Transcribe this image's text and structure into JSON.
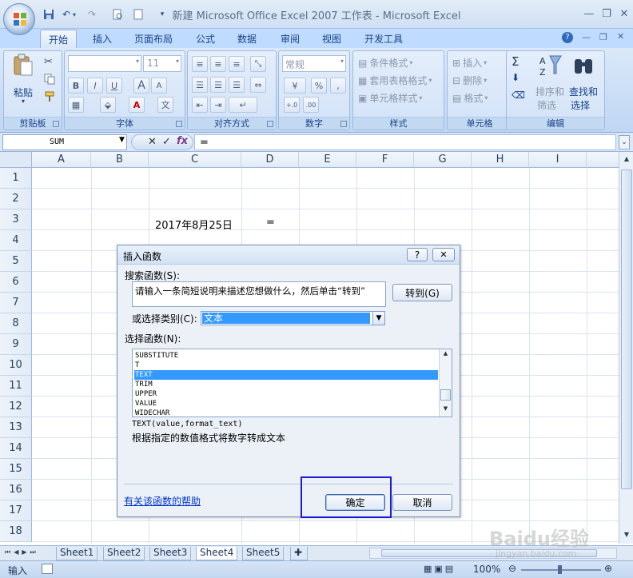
{
  "window": {
    "title": "新建 Microsoft Office Excel 2007 工作表 - Microsoft Excel"
  },
  "tabs": [
    "开始",
    "插入",
    "页面布局",
    "公式",
    "数据",
    "审阅",
    "视图",
    "开发工具"
  ],
  "ribbon": {
    "clipboard": {
      "paste_label": "粘贴",
      "group_label": "剪贴板"
    },
    "font": {
      "font_size": "11",
      "group_label": "字体",
      "bold": "B",
      "italic": "I",
      "underline": "U",
      "grow": "A",
      "shrink": "A",
      "font_color": "A",
      "phonetic": "文"
    },
    "alignment": {
      "group_label": "对齐方式"
    },
    "number": {
      "format": "常规",
      "percent": "%",
      "group_label": "数字"
    },
    "styles": {
      "cond_format": "条件格式",
      "table_format": "套用表格格式",
      "cell_style": "单元格样式",
      "group_label": "样式"
    },
    "cells": {
      "insert": "插入",
      "delete": "删除",
      "format": "格式",
      "group_label": "单元格"
    },
    "editing": {
      "sigma": "Σ",
      "sort_filter_1": "排序和",
      "sort_filter_2": "筛选",
      "find_select_1": "查找和",
      "find_select_2": "选择",
      "group_label": "编辑"
    }
  },
  "formula_bar": {
    "name_box": "SUM",
    "cancel": "✕",
    "enter": "✓",
    "fx": "fx",
    "content": "="
  },
  "grid": {
    "columns": [
      "A",
      "B",
      "C",
      "D",
      "E",
      "F",
      "G",
      "H",
      "I"
    ],
    "rows": [
      "1",
      "2",
      "3",
      "4",
      "5",
      "6",
      "7",
      "8",
      "9",
      "10",
      "11",
      "12",
      "13",
      "14",
      "15",
      "16",
      "17",
      "18"
    ],
    "cells": {
      "C3": "2017年8月25日",
      "D3": "="
    }
  },
  "sheets": [
    "Sheet1",
    "Sheet2",
    "Sheet3",
    "Sheet4",
    "Sheet5"
  ],
  "active_sheet": "Sheet4",
  "status": {
    "mode": "输入",
    "zoom": "100%"
  },
  "dialog": {
    "title": "插入函数",
    "help_btn": "?",
    "search_label": "搜索函数(S):",
    "search_value": "请输入一条简短说明来描述您想做什么，然后单击“转到”",
    "goto_button": "转到(G)",
    "category_label": "或选择类别(C):",
    "category_value": "文本",
    "select_label": "选择函数(N):",
    "functions": [
      "SUBSTITUTE",
      "T",
      "TEXT",
      "TRIM",
      "UPPER",
      "VALUE",
      "WIDECHAR"
    ],
    "selected_function": "TEXT",
    "syntax": "TEXT(value,format_text)",
    "description": "根据指定的数值格式将数字转成文本",
    "help_link": "有关该函数的帮助",
    "ok_button": "确定",
    "cancel_button": "取消"
  },
  "watermark": {
    "text": "Baidu经验",
    "url": "jingyan.baidu.com"
  }
}
